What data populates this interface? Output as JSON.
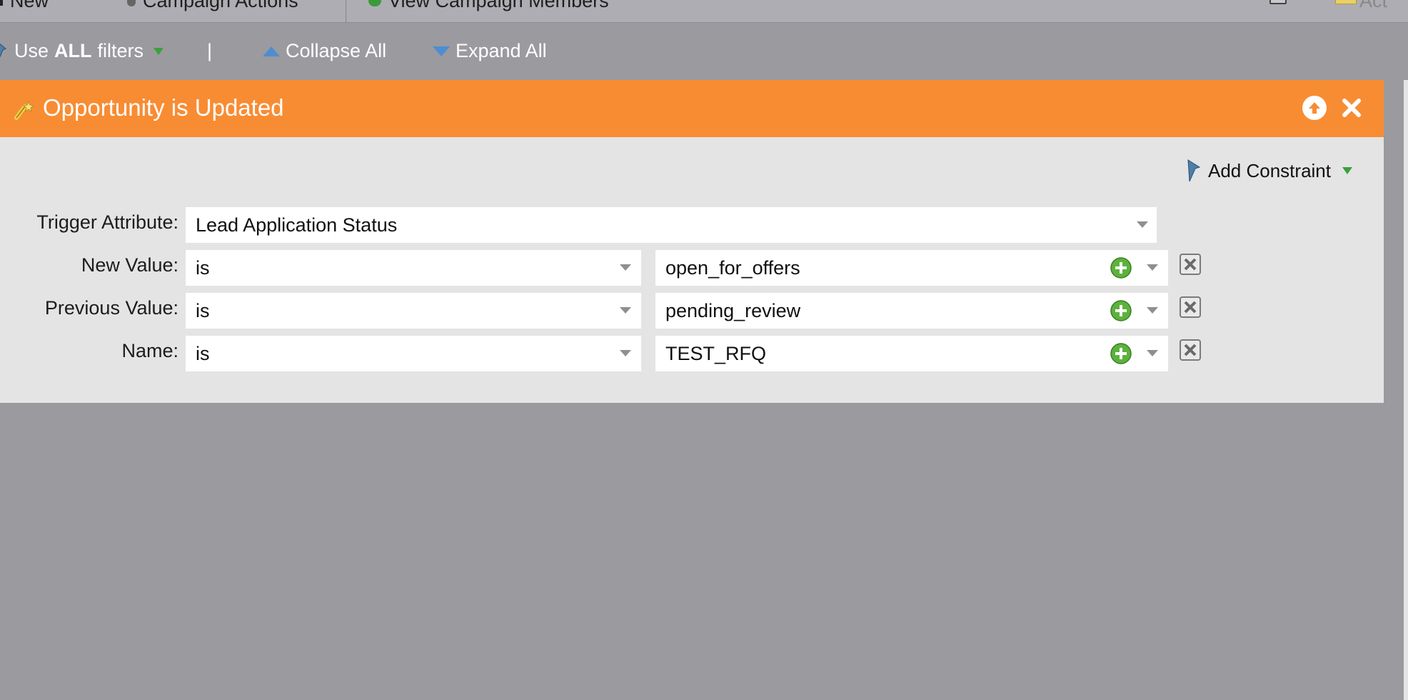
{
  "toolbar": {
    "new_label": "New",
    "campaign_actions_label": "Campaign Actions",
    "view_members_label": "View Campaign Members",
    "right_label": "Act"
  },
  "filters": {
    "use_prefix": "Use",
    "use_bold": "ALL",
    "use_suffix": "filters",
    "separator": "|",
    "collapse_label": "Collapse All",
    "expand_label": "Expand All"
  },
  "panel": {
    "title": "Opportunity is Updated",
    "add_constraint_label": "Add Constraint",
    "trigger": {
      "label": "Trigger Attribute:",
      "value": "Lead Application Status"
    },
    "constraints": [
      {
        "label": "New Value:",
        "operator": "is",
        "value": "open_for_offers"
      },
      {
        "label": "Previous Value:",
        "operator": "is",
        "value": "pending_review"
      },
      {
        "label": "Name:",
        "operator": "is",
        "value": "TEST_RFQ"
      }
    ]
  },
  "colors": {
    "header_orange": "#f88c33",
    "panel_bg": "#e4e4e4",
    "page_bg": "#9b9a9f",
    "accent_green": "#3aa13a",
    "accent_blue": "#4d8ed0"
  },
  "icons": {
    "header": "trigger-wand-icon",
    "move_up": "arrow-up-circle-icon",
    "close": "close-icon",
    "add_constraint": "wand-icon",
    "add_value": "plus-circle-icon",
    "delete": "delete-box-icon"
  }
}
